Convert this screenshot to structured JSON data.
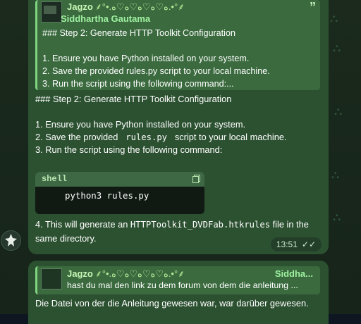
{
  "chat": {
    "quote": {
      "name": "Jagzo",
      "decor": "⸙°•.ﻩ♡ﻩ♡ﻩ♡ﻩ♡ﻩ.•°⸙",
      "sender": "Siddhartha Gautama",
      "icon": "quote-icon",
      "text": "### Step 2: Generate HTTP Toolkit Configuration\n\n1. Ensure you have Python installed on your system.\n2. Save the provided rules.py script to your local machine.\n3. Run the script using the following command:..."
    },
    "message": {
      "body": "### Step 2: Generate HTTP Toolkit Configuration\n\n1. Ensure you have Python installed on your system.\n2. Save the provided rules.py script to your local machine.\n3. Run the script using the following command:",
      "inline_code_1": "rules.py",
      "code_block": {
        "language": "shell",
        "code": "python3 rules.py",
        "copy_icon": "copy-icon"
      },
      "step4_prefix": "4. This will generate an ",
      "step4_code": "HTTPToolkit_DVDFab.htkrules",
      "step4_suffix": " file in the same directory.",
      "time": "13:51",
      "status": "read"
    },
    "avatar": {
      "icon": "avatar-icon"
    },
    "reply": {
      "quote_name": "Jagzo",
      "quote_decor": "⸙°•.ﻩ♡ﻩ♡ﻩ♡ﻩ♡ﻩ.•°⸙",
      "quote_sender": "Siddha...",
      "quote_text": "hast du mal den link zu dem forum von dem die anleitung ...",
      "text": "Die Datei von der die Anleitung gewesen war, war darüber gewesen."
    },
    "colors": {
      "bubble": "#2c5131",
      "quote_bar": "#7fd47f",
      "background": "#16241a"
    }
  }
}
